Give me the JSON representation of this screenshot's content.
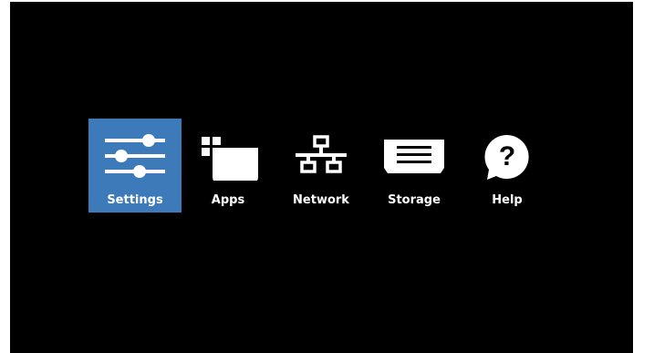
{
  "colors": {
    "screen_background": "#000000",
    "selected_background": "#3d7ab9",
    "icon": "#ffffff",
    "label": "#ffffff"
  },
  "menu": {
    "selected_index": 0,
    "items": [
      {
        "label": "Settings",
        "icon": "sliders-icon"
      },
      {
        "label": "Apps",
        "icon": "apps-icon"
      },
      {
        "label": "Network",
        "icon": "network-icon"
      },
      {
        "label": "Storage",
        "icon": "storage-icon"
      },
      {
        "label": "Help",
        "icon": "help-icon"
      }
    ]
  }
}
